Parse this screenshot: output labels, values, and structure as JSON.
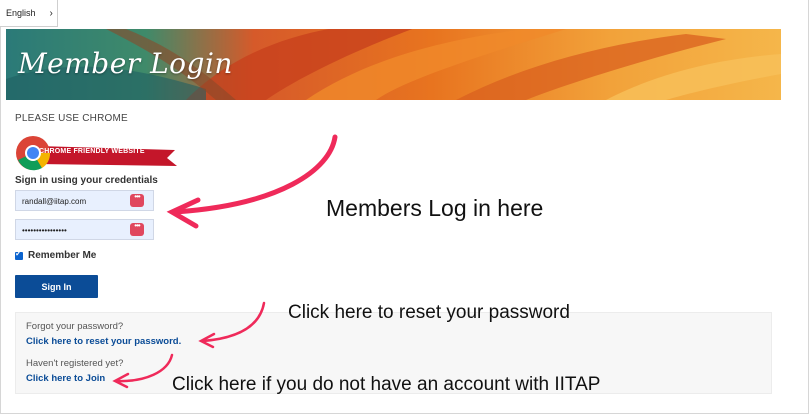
{
  "language": {
    "label": "English"
  },
  "banner": {
    "title": "Member Login"
  },
  "notice": {
    "text": "PLEASE USE CHROME"
  },
  "chrome_badge": {
    "text": "CHROME FRIENDLY WEBSITE"
  },
  "login": {
    "heading": "Sign in using your credentials",
    "username_value": "randall@iitap.com",
    "password_value": "••••••••••••••••",
    "remember_label": "Remember Me",
    "signin_label": "Sign In"
  },
  "help": {
    "forgot_text": "Forgot your password?",
    "reset_link": "Click here to reset your password.",
    "register_text": "Haven't registered yet?",
    "join_link": "Click here to Join"
  },
  "annotations": {
    "members": "Members Log in here",
    "reset": "Click here to reset your password",
    "join": "Click here if you do not have an account with IITAP"
  },
  "colors": {
    "arrow": "#ef2a5a",
    "primary": "#0b4c97",
    "key_badge": "#e0475e"
  }
}
